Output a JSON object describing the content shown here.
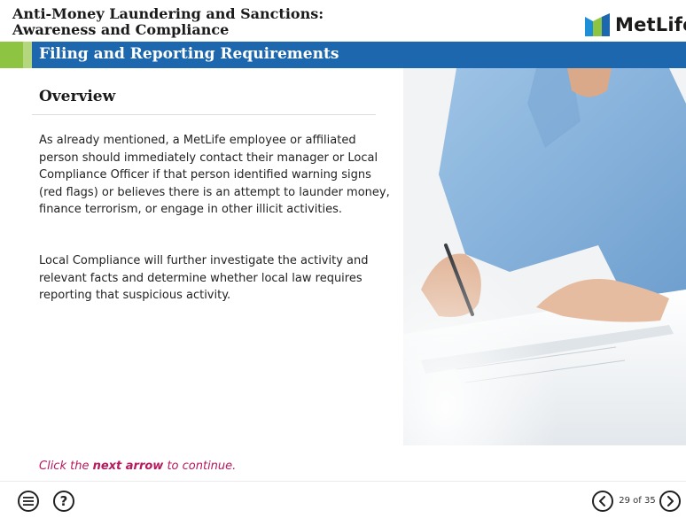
{
  "course": {
    "title_line1": "Anti-Money Laundering and Sanctions:",
    "title_line2": "Awareness and Compliance"
  },
  "brand": {
    "logo_text": "MetLife",
    "colors": {
      "blue": "#1c67ad",
      "green": "#8dc543",
      "light_green": "#b4d67c",
      "accent": "#b5195e"
    }
  },
  "section": {
    "title": "Filing and Reporting Requirements"
  },
  "content": {
    "heading": "Overview",
    "paragraphs": [
      "As already mentioned, a MetLife employee or affiliated person should immediately contact their manager or Local Compliance Officer if that person identified warning signs (red flags) or believes there is an attempt to launder money, finance terrorism, or engage in other illicit activities.",
      "Local Compliance will further investigate the activity and relevant facts and determine whether local law requires reporting that suspicious activity."
    ]
  },
  "prompt": {
    "prefix": "Click the ",
    "emphasis": "next arrow",
    "suffix": " to continue."
  },
  "footer": {
    "menu_icon": "menu-icon",
    "help_label": "?",
    "prev_icon": "chevron-left-icon",
    "next_icon": "chevron-right-icon",
    "page_counter": "29 of 35"
  }
}
